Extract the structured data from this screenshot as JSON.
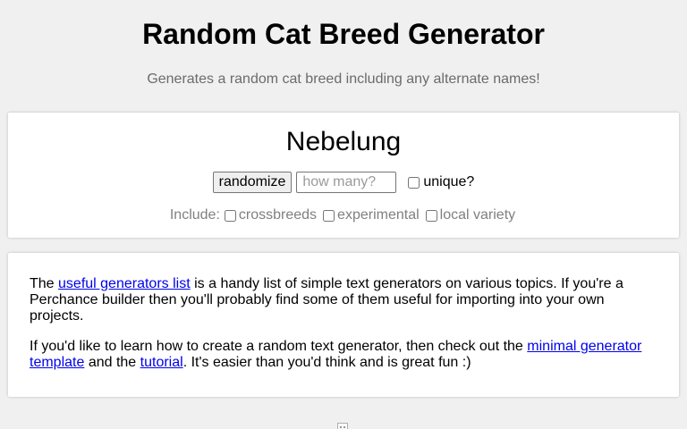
{
  "header": {
    "title": "Random Cat Breed Generator",
    "subtitle": "Generates a random cat breed including any alternate names!"
  },
  "generator": {
    "result": "Nebelung",
    "randomize_label": "randomize",
    "count_placeholder": "how many?",
    "unique_label": "unique?",
    "unique_checked": false,
    "include_label": "Include:",
    "options": [
      {
        "label": "crossbreeds",
        "checked": false
      },
      {
        "label": "experimental",
        "checked": false
      },
      {
        "label": "local variety",
        "checked": false
      }
    ]
  },
  "info": {
    "p1_before": "The ",
    "p1_link": "useful generators list",
    "p1_after": " is a handy list of simple text generators on various topics. If you're a Perchance builder then you'll probably find some of them useful for importing into your own projects.",
    "p2_before": "If you'd like to learn how to create a random text generator, then check out the ",
    "p2_link1": "minimal generator template",
    "p2_mid": " and the ",
    "p2_link2": "tutorial",
    "p2_after": ". It's easier than you'd think and is great fun :)",
    "link_color": "#0000ee"
  },
  "footer": {
    "icon": "broken-image-icon"
  }
}
